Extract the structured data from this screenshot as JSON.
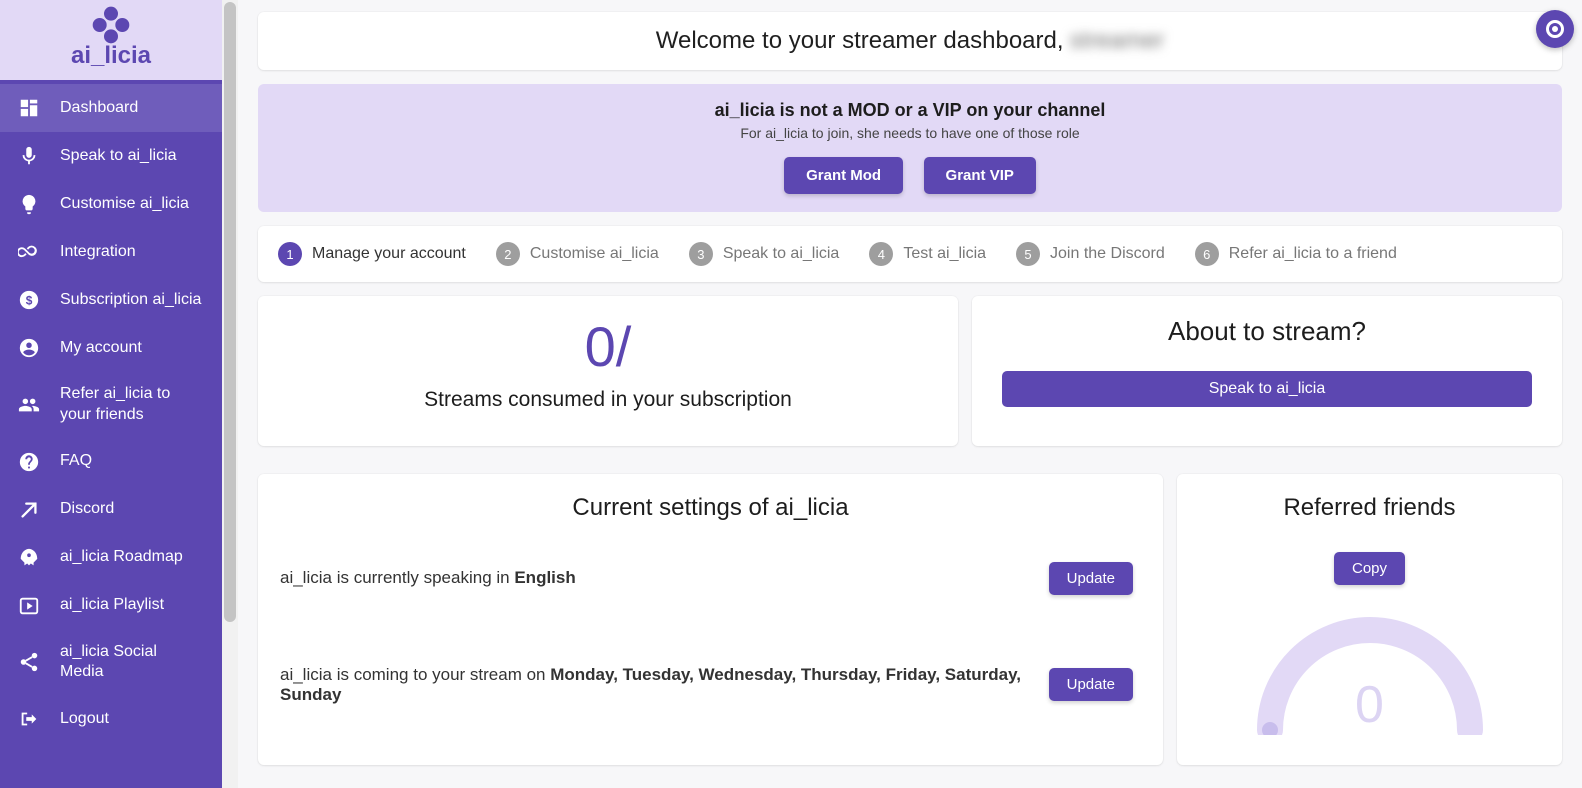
{
  "brand": "ai_licia",
  "sidebar": {
    "items": [
      {
        "label": "Dashboard"
      },
      {
        "label": "Speak to ai_licia"
      },
      {
        "label": "Customise ai_licia"
      },
      {
        "label": "Integration"
      },
      {
        "label": "Subscription ai_licia"
      },
      {
        "label": "My account"
      },
      {
        "label": "Refer ai_licia to your friends"
      },
      {
        "label": "FAQ"
      },
      {
        "label": "Discord"
      },
      {
        "label": "ai_licia Roadmap"
      },
      {
        "label": "ai_licia Playlist"
      },
      {
        "label": "ai_licia Social Media"
      },
      {
        "label": "Logout"
      }
    ]
  },
  "welcome": {
    "prefix": "Welcome to your streamer dashboard, ",
    "username": "streamer"
  },
  "notice": {
    "title": "ai_licia is not a MOD or a VIP on your channel",
    "subtitle": "For ai_licia to join, she needs to have one of those role",
    "grant_mod": "Grant Mod",
    "grant_vip": "Grant VIP"
  },
  "steps": [
    {
      "num": "1",
      "label": "Manage your account",
      "active": true
    },
    {
      "num": "2",
      "label": "Customise ai_licia",
      "active": false
    },
    {
      "num": "3",
      "label": "Speak to ai_licia",
      "active": false
    },
    {
      "num": "4",
      "label": "Test ai_licia",
      "active": false
    },
    {
      "num": "5",
      "label": "Join the Discord",
      "active": false
    },
    {
      "num": "6",
      "label": "Refer ai_licia to a friend",
      "active": false
    }
  ],
  "streams": {
    "count": "0/",
    "caption": "Streams consumed in your subscription"
  },
  "about": {
    "title": "About to stream?",
    "button": "Speak to ai_licia"
  },
  "settings": {
    "title": "Current settings of ai_licia",
    "lang_prefix": "ai_licia is currently speaking in ",
    "lang_value": "English",
    "days_prefix": "ai_licia is coming to your stream on ",
    "days_value": "Monday, Tuesday, Wednesday, Thursday, Friday, Saturday, Sunday",
    "update": "Update"
  },
  "referred": {
    "title": "Referred friends",
    "copy": "Copy",
    "value": "0"
  }
}
